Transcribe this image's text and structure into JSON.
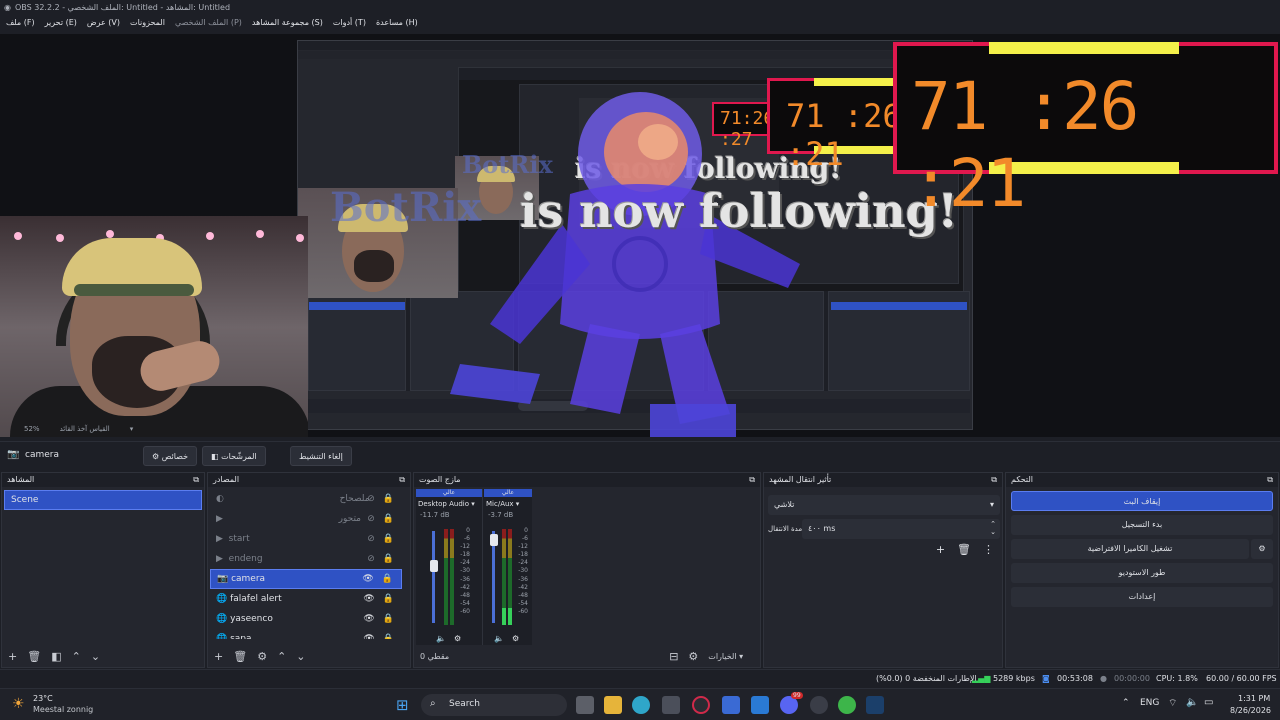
{
  "window": {
    "title": "OBS 32.2.2 - الملف الشخصي: Untitled - المشاهد: Untitled"
  },
  "menu": [
    {
      "label": "ملف (F)"
    },
    {
      "label": "تحرير (E)"
    },
    {
      "label": "عرض (V)"
    },
    {
      "label": "المحزونات"
    },
    {
      "label": "الملف الشخصي (P)"
    },
    {
      "label": "مجموعة المشاهد (S)"
    },
    {
      "label": "أدوات (T)"
    },
    {
      "label": "مساعدة (H)"
    }
  ],
  "preview": {
    "overlay_text": "is now following!",
    "overlay_name": "BotRix",
    "timer": "71 :26 :21",
    "timer_mid": "71 :26 :21",
    "timer_small": "71:26 :27",
    "zoom": "52%",
    "zoom_caption": "القياس آخذ القائد"
  },
  "source_toolbar": {
    "source_name": "camera",
    "properties": "خصائص",
    "filters": "المرشّحات",
    "deactivate": "إلغاء التنشيط"
  },
  "scenes": {
    "title": "المشاهد",
    "items": [
      {
        "label": "Scene"
      }
    ]
  },
  "sources": {
    "title": "المصادر",
    "items": [
      {
        "label": "ملصحاح",
        "visible": false
      },
      {
        "label": "متحور",
        "visible": false
      },
      {
        "label": "start",
        "visible": false
      },
      {
        "label": "endeng",
        "visible": false
      },
      {
        "label": "camera",
        "visible": true,
        "selected": true
      },
      {
        "label": "falafel alert",
        "visible": true
      },
      {
        "label": "yaseenco",
        "visible": true
      },
      {
        "label": "sapa",
        "visible": true
      }
    ]
  },
  "mixer": {
    "title": "مازج الصوت",
    "channels": [
      {
        "header": "عالي",
        "name": "Desktop Audio",
        "db": "-11.7 dB",
        "level": 0.0,
        "fader": 0.62
      },
      {
        "header": "عالي",
        "name": "Mic/Aux",
        "db": "-3.7 dB",
        "level": 0.18,
        "fader": 0.9
      }
    ],
    "scale": [
      "0",
      "-6",
      "-12",
      "-18",
      "-24",
      "-30",
      "-36",
      "-42",
      "-48",
      "-54",
      "-60"
    ],
    "footer": "مقطي 0"
  },
  "transitions": {
    "title": "تأثير انتقال المشهد",
    "type": "تلاشي",
    "duration_label": "مدة الانتقال",
    "duration_value": "٤٠٠ ms"
  },
  "controls": {
    "title": "التحكم",
    "buttons": [
      {
        "label": "إيقاف البث",
        "active": true
      },
      {
        "label": "بدء التسجيل"
      },
      {
        "label": "تشغيل الكاميرا الافتراضية"
      },
      {
        "label": "طور الاستوديو"
      },
      {
        "label": "إعدادات"
      }
    ],
    "options_label": "الخيارات"
  },
  "statusbar": {
    "dropped": "الإطارات المنخفضة 0 (0.0%)",
    "bitrate": "5289 kbps",
    "stream_time": "00:53:08",
    "rec_time": "00:00:00",
    "cpu": "CPU: 1.8%",
    "fps": "60.00 / 60.00 FPS"
  },
  "taskbar": {
    "weather_temp": "23°C",
    "weather_desc": "Meestal zonnig",
    "search": "Search",
    "lang": "ENG",
    "time": "1:31 PM",
    "date": "8/26/2026",
    "badge": "99"
  },
  "colors": {
    "accent": "#2f52c4",
    "timer_orange": "#f28a2a",
    "timer_border": "#e0184e",
    "timer_yellow": "#f4f04a"
  }
}
